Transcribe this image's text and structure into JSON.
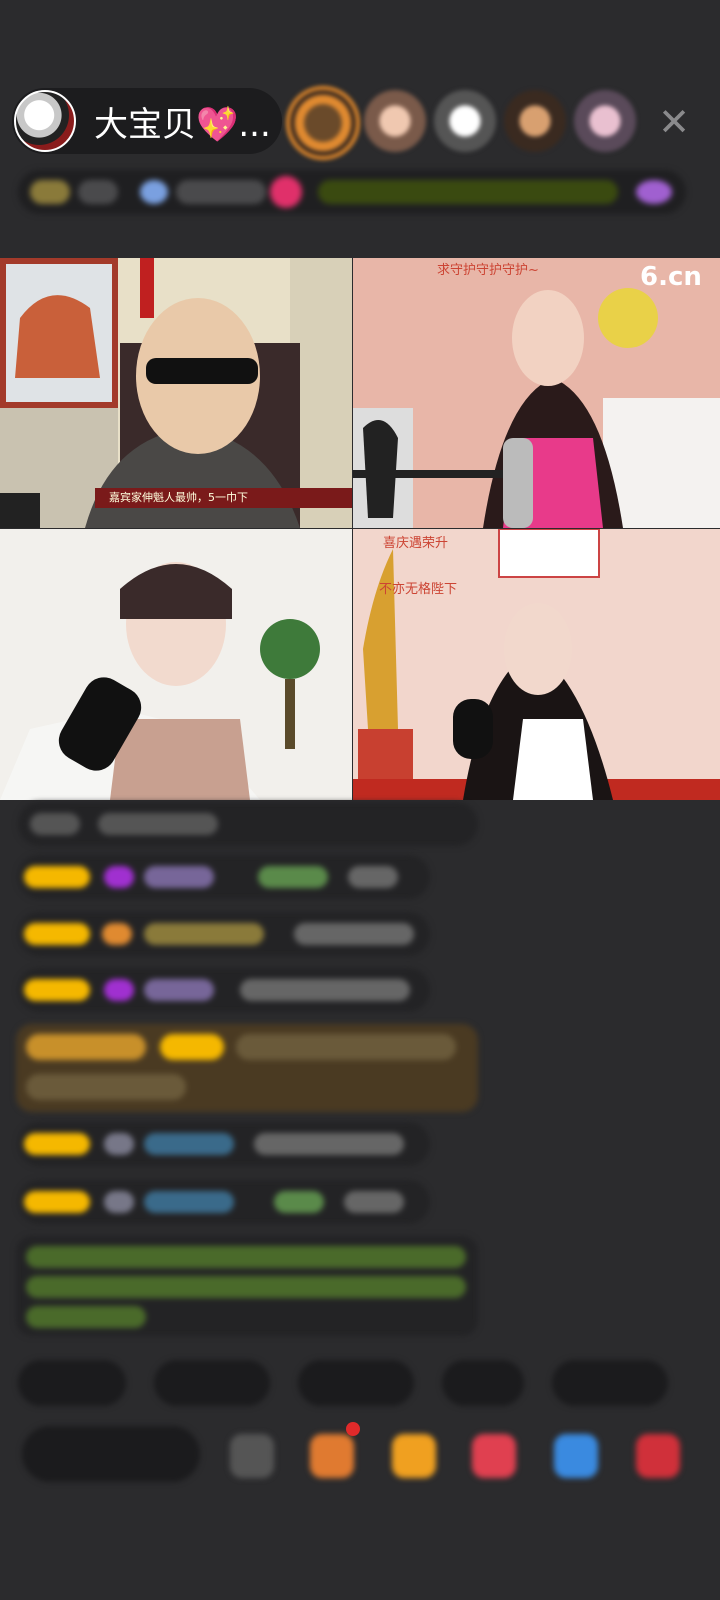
{
  "header": {
    "host_name": "大宝贝💖...",
    "close_glyph": "✕",
    "viewer_count": 5
  },
  "videos": {
    "watermark": "6.cn",
    "caption_1": "嘉宾家伸魁人最帅，5一巾下",
    "wall_text_1": "求守护守护守护~",
    "wall_text_2": "喜庆遇荣升",
    "wall_text_3": "不亦无格陛下"
  },
  "colors": {
    "accent_orange": "#e58b2c",
    "badge_yellow": "#f5b800",
    "chat_bg": "#232325",
    "page_bg": "#2b2b2d"
  }
}
